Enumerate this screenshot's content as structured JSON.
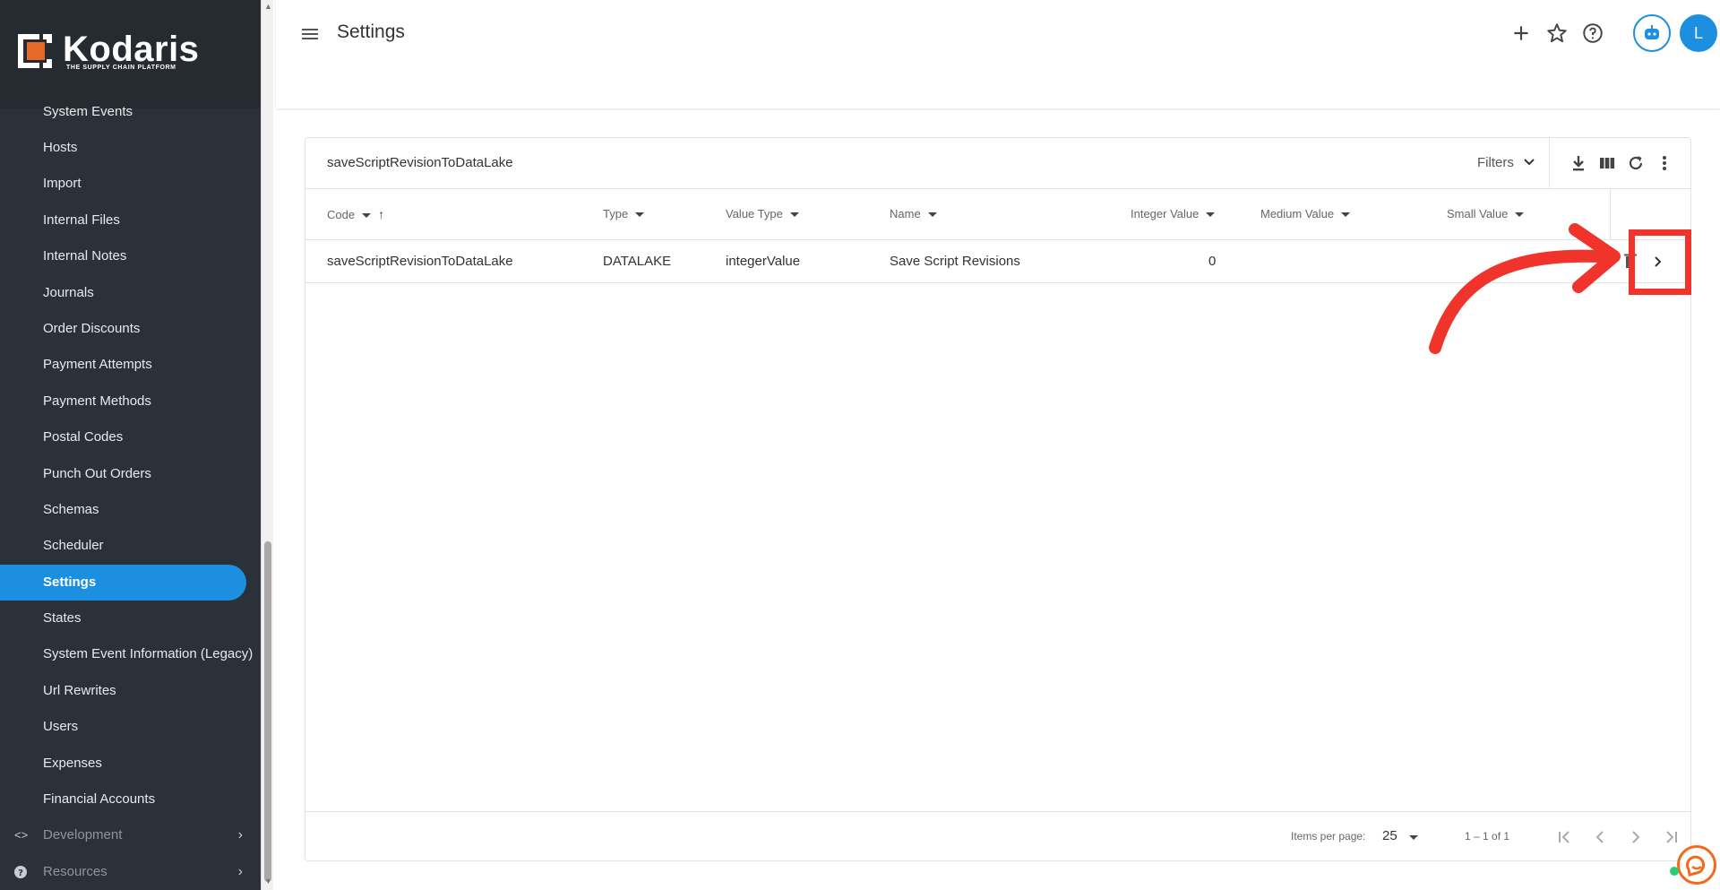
{
  "brand": {
    "name": "Kodaris",
    "tagline": "THE SUPPLY CHAIN PLATFORM",
    "accent": "#1c8fe0",
    "annotation_color": "#f0342b"
  },
  "sidebar": {
    "items": [
      {
        "label": "System Events"
      },
      {
        "label": "Hosts"
      },
      {
        "label": "Import"
      },
      {
        "label": "Internal Files"
      },
      {
        "label": "Internal Notes"
      },
      {
        "label": "Journals"
      },
      {
        "label": "Order Discounts"
      },
      {
        "label": "Payment Attempts"
      },
      {
        "label": "Payment Methods"
      },
      {
        "label": "Postal Codes"
      },
      {
        "label": "Punch Out Orders"
      },
      {
        "label": "Schemas"
      },
      {
        "label": "Scheduler"
      },
      {
        "label": "Settings",
        "active": true
      },
      {
        "label": "States"
      },
      {
        "label": "System Event Information (Legacy)"
      },
      {
        "label": "Url Rewrites"
      },
      {
        "label": "Users"
      },
      {
        "label": "Expenses"
      },
      {
        "label": "Financial Accounts"
      }
    ],
    "groups": [
      {
        "label": "Development",
        "icon": "code-icon"
      },
      {
        "label": "Resources",
        "icon": "help-circle-icon"
      }
    ]
  },
  "header": {
    "title": "Settings",
    "avatar_initial": "L",
    "icons": [
      "add-icon",
      "star-icon",
      "help-icon",
      "bot-icon"
    ]
  },
  "table": {
    "title": "saveScriptRevisionToDataLake",
    "filters_label": "Filters",
    "columns": [
      "Code",
      "Type",
      "Value Type",
      "Name",
      "Integer Value",
      "Medium Value",
      "Small Value"
    ],
    "rows": [
      {
        "code": "saveScriptRevisionToDataLake",
        "type": "DATALAKE",
        "value_type": "integerValue",
        "name": "Save Script Revisions",
        "integer_value": "0",
        "medium_value": "",
        "small_value": ""
      }
    ],
    "footer": {
      "items_per_page_label": "Items per page:",
      "items_per_page": "25",
      "range": "1 – 1 of 1"
    }
  }
}
